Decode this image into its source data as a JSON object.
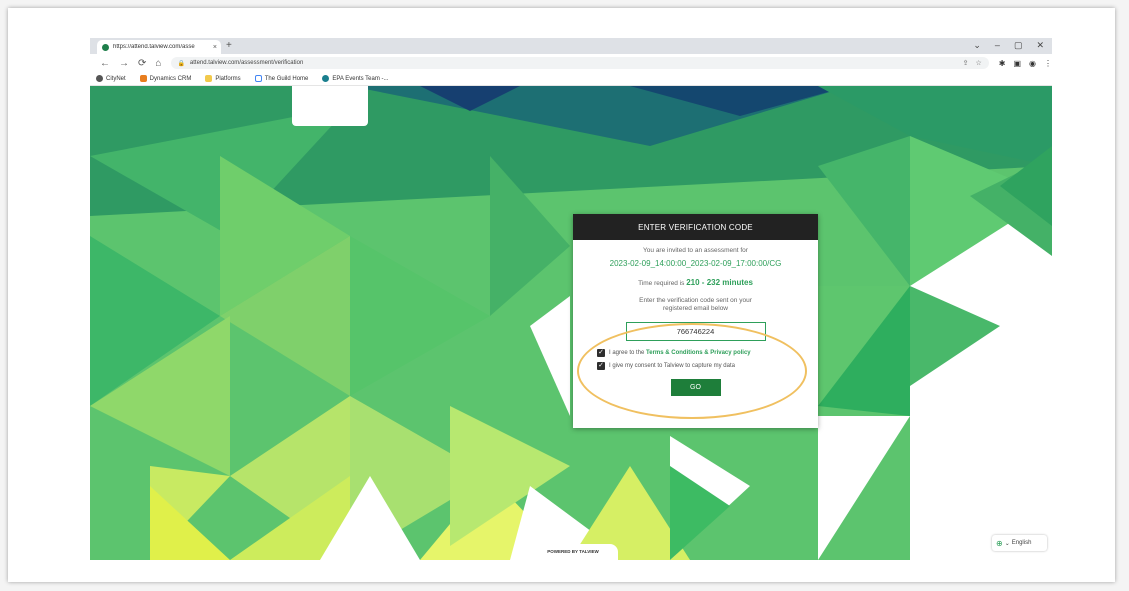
{
  "browser": {
    "tab_title": "https://attend.talview.com/asse",
    "tab_close": "×",
    "new_tab": "+",
    "url": "attend.talview.com/assessment/verification",
    "window_controls": [
      "⌄",
      "–",
      "▢",
      "✕"
    ],
    "nav_icons": [
      "←",
      "→",
      "⟳",
      "⌂"
    ],
    "bookmarks": [
      "CityNet",
      "Dynamics CRM",
      "Platforms",
      "The Guild Home",
      "EPA Events Team -..."
    ]
  },
  "dialog": {
    "header": "ENTER VERIFICATION CODE",
    "invite_text": "You are invited to an assessment for",
    "schedule": "2023-02-09_14:00:00_2023-02-09_17:00:00/CG",
    "time_prefix": "Time required is",
    "time_value": "210 - 232 minutes",
    "instruction": "Enter the verification code sent on your registered email below",
    "code_value": "766746224",
    "agree_prefix": "I agree to the",
    "terms_link": "Terms & Conditions & Privacy policy",
    "consent_text": "I give my consent to Talview to capture my data",
    "go_label": "GO"
  },
  "footer": {
    "powered_by": "POWERED BY TALVIEW",
    "language": "English"
  },
  "colors": {
    "accent_green": "#2e9f5a",
    "go_button": "#1e7e3a",
    "header_dark": "#222222",
    "highlight_oval": "#f0c060"
  }
}
